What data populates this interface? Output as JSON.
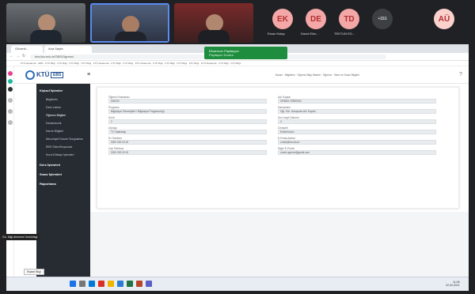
{
  "meeting": {
    "participants": [
      {
        "initials": "EK",
        "name": "Ersan Kalay",
        "color": "#f4a7a7"
      },
      {
        "initials": "DE",
        "name": "Davut Ekin...",
        "color": "#f4a7a7"
      },
      {
        "initials": "TD",
        "name": "TEKTUN ED...",
        "color": "#f4a7a7"
      }
    ],
    "more_label": "+151",
    "self_initials": "AÜ",
    "self_color": "#fbd1cd"
  },
  "browser": {
    "tabs": [
      "Güvenli...",
      "Ana Sayfa"
    ],
    "url": "ebs.ktu.edu.tr/OBS/Ogrenci",
    "bookmarks": "KTÜ Akademik · EBS · KTÜ Bilgi · KTÜ Bilgi · KTÜ Bilgi · KTÜ Bilgi · KTÜ Akademik · KTÜ Bilgi · KTÜ Bilgi · KTÜ Akademik · KTÜ Bilgi · KTÜ Bilgi · KTÜ Bilgi · KTÜ Bilgi · KTÜ Akademik · KTÜ Bilgi · KTÜ Bilgi"
  },
  "share_banner": {
    "line1": "Ekranınızı Paylaşıyor",
    "line2": "Paylaşımı Durdur"
  },
  "app": {
    "logo": "KTÜ",
    "logo_sub": "EBS",
    "breadcrumb": "Nizam · Bilgilerim · Öğrenci Bilgi Sistemi · Öğrenci · Ödev ve Sınav Bilgileri"
  },
  "sidebar": {
    "sections": [
      {
        "label": "Kişisel İşlemler",
        "items": [
          "Bilgilerim",
          "Ders Listesi",
          "Öğrenci Bilgileri",
          "Devamsızlık",
          "Karne Bilgileri",
          "Mezuniyet Durum Sorgulama",
          "EBS Ödev/Duyurular",
          "Kurul Dilekçe İşlemleri"
        ]
      },
      {
        "label": "Ders İşlemleri",
        "items": []
      },
      {
        "label": "Sınav İşlemleri",
        "items": []
      },
      {
        "label": "Raporlama",
        "items": []
      }
    ]
  },
  "form": {
    "left": [
      {
        "label": "Öğrenci Numarası",
        "value": "000000"
      },
      {
        "label": "Programı",
        "value": "Bilgisayar Teknolojileri / Bilgisayar Programcılığı"
      },
      {
        "label": "Sınıfı",
        "value": "2"
      },
      {
        "label": "Uyruğu",
        "value": "TC Vatandaşı"
      },
      {
        "label": "Ev Telefonu",
        "value": "0000 000 00 00"
      },
      {
        "label": "Cep Telefonu",
        "value": "0000 000 00 00"
      }
    ],
    "right": [
      {
        "label": "Adı Soyadı",
        "value": "ÖRNEK ÖĞRENCİ"
      },
      {
        "label": "Danışmanı",
        "value": "Öğr. Gör. Danışman Adı Soyadı"
      },
      {
        "label": "Son Kayıt Dönemi",
        "value": "3"
      },
      {
        "label": "Cinsiyeti",
        "value": "Erkek/Kadın"
      },
      {
        "label": "E-Posta Adresi",
        "value": "ornek@ktu.edu.tr"
      },
      {
        "label": "Diğer E-Posta",
        "value": "ornek.ogrenci@gmail.com"
      }
    ]
  },
  "tooltip": "Kişisel Bilgi",
  "taskbar": {
    "clock": "11:08",
    "date": "22.04.2021",
    "label": "Go. bilgi deneme/ ösrs/elsgi"
  }
}
